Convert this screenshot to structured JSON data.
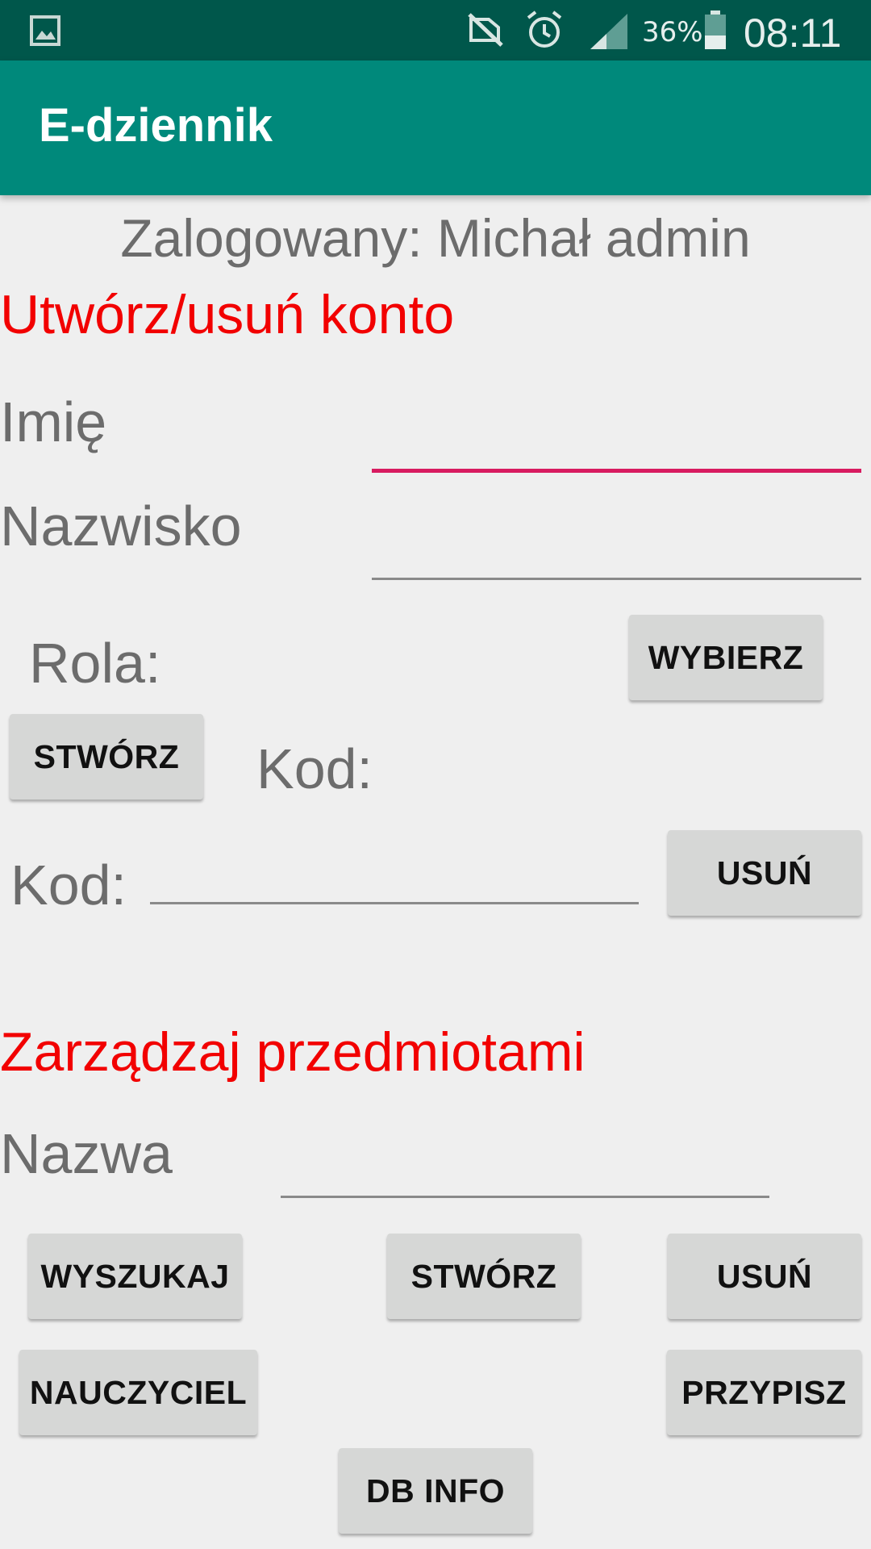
{
  "status_bar": {
    "battery": "36%",
    "time": "08:11",
    "icons": [
      "gallery-icon",
      "mute-icon",
      "alarm-icon",
      "signal-icon",
      "battery-icon"
    ]
  },
  "app_bar": {
    "title": "E-dziennik"
  },
  "logged_in": "Zalogowany: Michał  admin",
  "account_section": {
    "title": "Utwórz/usuń konto",
    "first_name_label": "Imię",
    "first_name_value": "",
    "last_name_label": "Nazwisko",
    "last_name_value": "",
    "role_label": "Rola:",
    "choose_button": "WYBIERZ",
    "create_button": "STWÓRZ",
    "generated_code_label": "Kod:",
    "code_label": "Kod:",
    "code_value": "",
    "delete_button": "USUŃ"
  },
  "subjects_section": {
    "title": "Zarządzaj przedmiotami",
    "name_label": "Nazwa",
    "name_value": "",
    "search_button": "WYSZUKAJ",
    "create_button": "STWÓRZ",
    "delete_button": "USUŃ",
    "teacher_button": "NAUCZYCIEL",
    "assign_button": "PRZYPISZ",
    "db_info_button": "DB INFO"
  },
  "colors": {
    "status_bar": "#00574b",
    "app_bar": "#00897b",
    "section_title": "#f20000",
    "field_focus": "#d81b60",
    "background": "#efefef"
  }
}
